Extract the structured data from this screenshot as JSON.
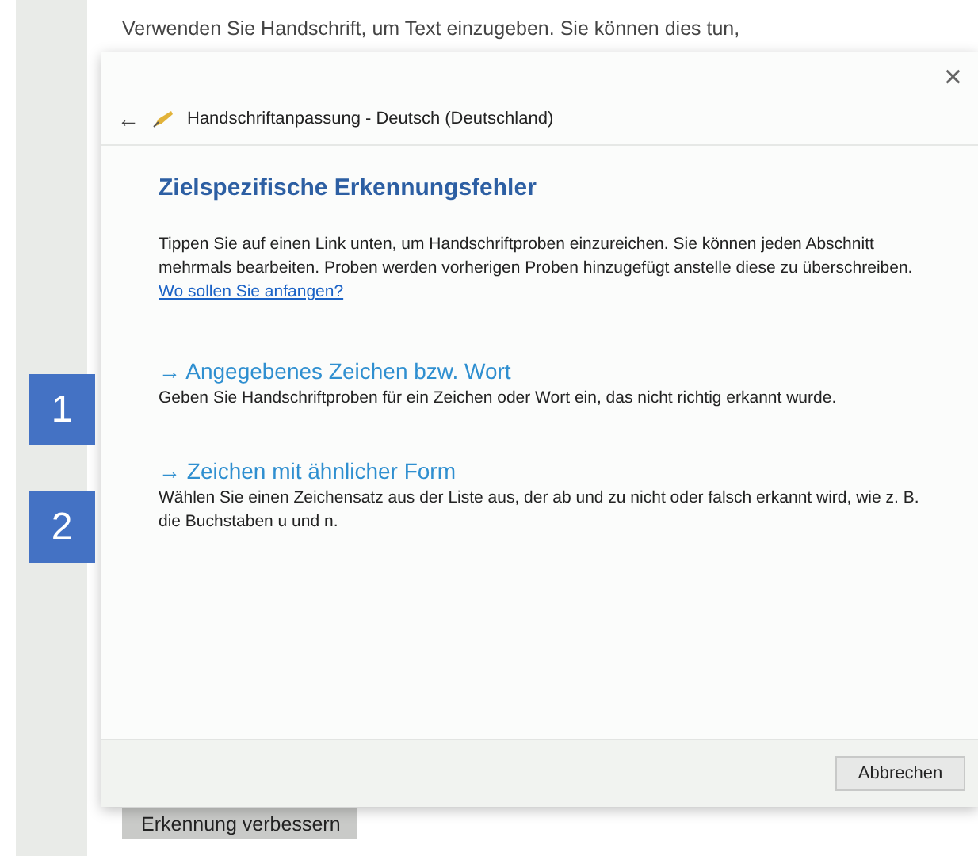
{
  "background_page": {
    "text": "Verwenden Sie Handschrift, um Text einzugeben. Sie können dies tun,",
    "button": "Erkennung verbessern"
  },
  "dialog": {
    "close": "×",
    "back": "←",
    "title": "Handschriftanpassung - Deutsch (Deutschland)",
    "heading": "Zielspezifische Erkennungsfehler",
    "intro": "Tippen Sie auf einen Link unten, um Handschriftproben einzureichen. Sie können jeden Abschnitt mehrmals bearbeiten. Proben werden vorherigen Proben hinzugefügt anstelle diese zu überschreiben.",
    "intro_link": "Wo sollen Sie anfangen?",
    "options": [
      {
        "arrow": "→",
        "label": "Angegebenes Zeichen bzw. Wort",
        "description": "Geben Sie Handschriftproben für ein Zeichen oder Wort ein, das nicht richtig erkannt wurde."
      },
      {
        "arrow": "→",
        "label": "Zeichen mit ähnlicher Form",
        "description": "Wählen Sie einen Zeichensatz aus der Liste aus, der ab und zu nicht oder falsch erkannt wird, wie z. B. die Buchstaben u und n."
      }
    ],
    "buttons": [
      "Abbrechen"
    ]
  },
  "callouts": [
    "1",
    "2"
  ]
}
